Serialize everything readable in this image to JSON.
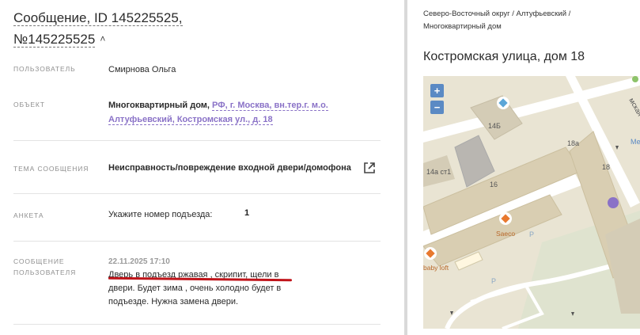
{
  "message": {
    "title": "Сообщение, ID 145225525, №145225525",
    "collapse_icon": "chevron-up-icon"
  },
  "fields": {
    "user": {
      "label": "ПОЛЬЗОВАТЕЛЬ",
      "value": "Смирнова Ольга"
    },
    "object": {
      "label": "ОБЪЕКТ",
      "value_prefix": "Многоквартирный дом,",
      "value_link": "РФ, г. Москва, вн.тер.г. м.о. Алтуфьевский, Костромская ул., д. 18"
    },
    "topic": {
      "label": "ТЕМА СООБЩЕНИЯ",
      "value": "Неисправность/повреждение входной двери/домофона",
      "action_icon": "external-link-icon"
    },
    "survey": {
      "label": "АНКЕТА",
      "question": "Укажите номер подъезда:",
      "answer": "1"
    },
    "user_message": {
      "label": "СООБЩЕНИЕ ПОЛЬЗОВАТЕЛЯ",
      "date": "22.11.2025 17:10",
      "text": "Дверь в подъезд ржавая , скрипит, щели в двери. Будет зима , очень холодно будет в подъезде. Нужна замена двери."
    }
  },
  "location": {
    "breadcrumb": "Северо-Восточный округ / Алтуфьевский / Многоквартирный дом",
    "address": "Костромская улица, дом 18"
  },
  "map": {
    "zoom_in": "+",
    "zoom_out": "−",
    "labels": {
      "building_14b": "14Б",
      "building_14a": "14а ст1",
      "building_16": "16",
      "building_18a": "18а",
      "building_18": "18",
      "poi_saeco": "Saeco",
      "poi_babyloft": "baby loft",
      "parking": "P",
      "parking2": "P",
      "street_fragment": "мская",
      "metro_fragment": "Ме"
    },
    "colors": {
      "marker": "#8a72c7",
      "poi": "#e8792f",
      "water": "#5ba6d8"
    }
  }
}
